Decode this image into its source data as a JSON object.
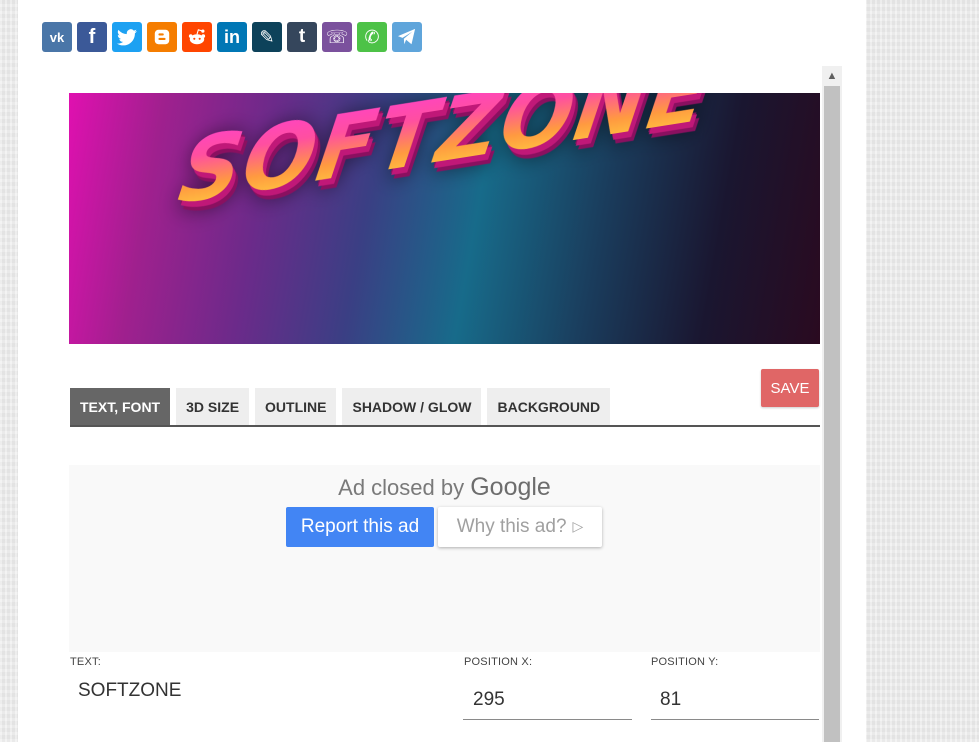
{
  "share_buttons": [
    {
      "name": "vk",
      "icon": "vk-icon",
      "color": "#4a76a8",
      "glyph": "vk"
    },
    {
      "name": "facebook",
      "icon": "facebook-icon",
      "color": "#3b5998",
      "glyph": "f"
    },
    {
      "name": "twitter",
      "icon": "twitter-icon",
      "color": "#1da1f2",
      "glyph": "t"
    },
    {
      "name": "blogger",
      "icon": "blogger-icon",
      "color": "#f57d00",
      "glyph": "B"
    },
    {
      "name": "reddit",
      "icon": "reddit-icon",
      "color": "#ff4500",
      "glyph": "r"
    },
    {
      "name": "linkedin",
      "icon": "linkedin-icon",
      "color": "#0077b5",
      "glyph": "in"
    },
    {
      "name": "livejournal",
      "icon": "livejournal-icon",
      "color": "#0d425a",
      "glyph": "✎"
    },
    {
      "name": "tumblr",
      "icon": "tumblr-icon",
      "color": "#35465c",
      "glyph": "t"
    },
    {
      "name": "viber",
      "icon": "viber-icon",
      "color": "#7b519d",
      "glyph": "☏"
    },
    {
      "name": "whatsapp",
      "icon": "whatsapp-icon",
      "color": "#4dc247",
      "glyph": "✆"
    },
    {
      "name": "telegram",
      "icon": "telegram-icon",
      "color": "#5fa5db",
      "glyph": "➤"
    }
  ],
  "banner": {
    "text": "SOFTZONE"
  },
  "tabs": [
    {
      "label": "TEXT, FONT",
      "active": true
    },
    {
      "label": "3D SIZE",
      "active": false
    },
    {
      "label": "OUTLINE",
      "active": false
    },
    {
      "label": "SHADOW / GLOW",
      "active": false
    },
    {
      "label": "BACKGROUND",
      "active": false
    }
  ],
  "save_label": "SAVE",
  "ad": {
    "closed_prefix": "Ad closed by ",
    "closed_brand": "Google",
    "report_label": "Report this ad",
    "why_label": "Why this ad?",
    "why_icon": "▷"
  },
  "fields": {
    "text_label": "TEXT:",
    "text_value": "SOFTZONE",
    "pos_x_label": "POSITION X:",
    "pos_x_value": "295",
    "pos_y_label": "POSITION Y:",
    "pos_y_value": "81"
  },
  "colors": {
    "accent_save": "#e06666",
    "report_blue": "#4285f4",
    "active_tab": "#666666"
  }
}
